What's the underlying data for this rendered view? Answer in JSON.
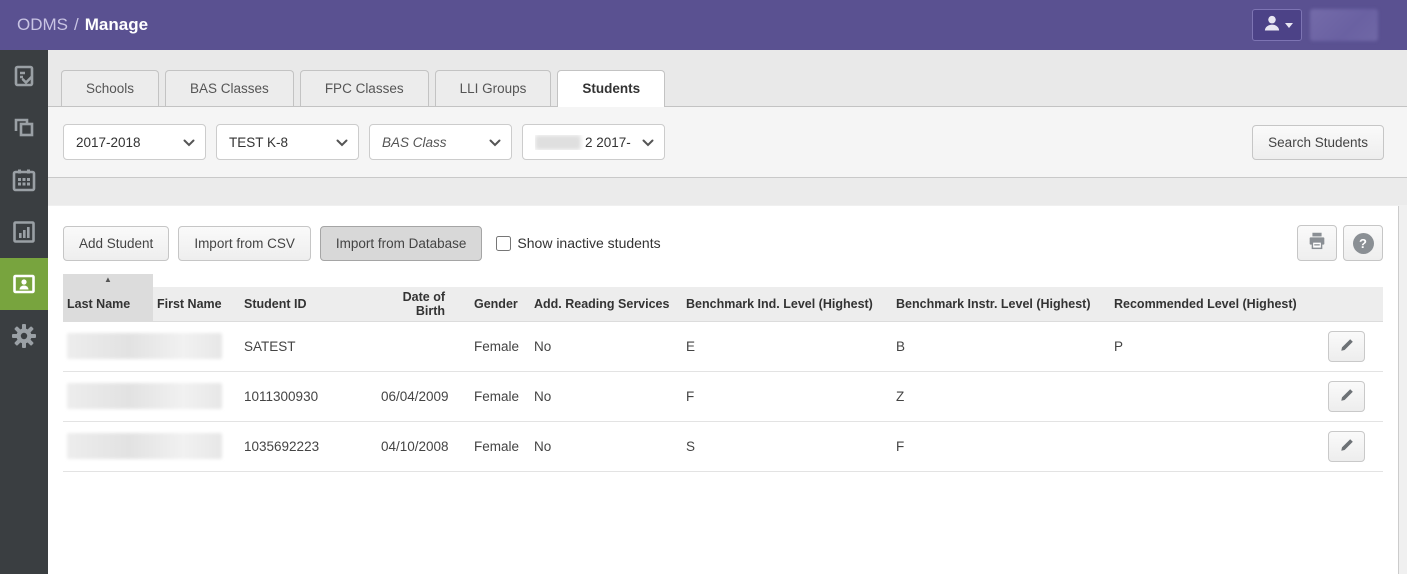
{
  "colors": {
    "accent_purple": "#5a5191",
    "accent_green": "#78a43e",
    "sidebar_bg": "#3a3e41"
  },
  "topbar": {
    "app": "ODMS",
    "separator": "/",
    "page": "Manage",
    "user_icon": "user-icon",
    "user_name_redacted": true
  },
  "sidebar": {
    "items": [
      {
        "icon": "assessment-checklist-icon",
        "active": false
      },
      {
        "icon": "classes-overlap-icon",
        "active": false
      },
      {
        "icon": "calendar-icon",
        "active": false
      },
      {
        "icon": "reports-chart-icon",
        "active": false
      },
      {
        "icon": "students-contact-card-icon",
        "active": true
      },
      {
        "icon": "settings-gear-icon",
        "active": false
      }
    ]
  },
  "tabs": {
    "items": [
      {
        "label": "Schools"
      },
      {
        "label": "BAS Classes"
      },
      {
        "label": "FPC Classes"
      },
      {
        "label": "LLI Groups"
      },
      {
        "label": "Students"
      }
    ],
    "active": "Students"
  },
  "filters": {
    "year_select": {
      "value": "2017-2018"
    },
    "school_select": {
      "value": "TEST K-8"
    },
    "class_type_select": {
      "value": "BAS Class",
      "italic": true
    },
    "class_select": {
      "redacted_prefix": true,
      "visible_text": "2 2017-"
    },
    "search_button": "Search Students"
  },
  "toolbar": {
    "add_student": "Add Student",
    "import_csv": "Import from CSV",
    "import_db": "Import from Database",
    "import_db_pressed": true,
    "show_inactive_label": "Show inactive students",
    "show_inactive_checked": false,
    "print_icon": "print-icon",
    "help_icon": "help-icon",
    "help_glyph": "?"
  },
  "table": {
    "sort": {
      "column": "Last Name",
      "direction": "asc",
      "arrow": "▲"
    },
    "columns": [
      "Last Name",
      "First Name",
      "Student ID",
      "Date of Birth",
      "Gender",
      "Add. Reading Services",
      "Benchmark Ind. Level (Highest)",
      "Benchmark Instr. Level (Highest)",
      "Recommended Level (Highest)"
    ],
    "rows": [
      {
        "name_redacted": true,
        "student_id": "SATEST",
        "dob": "",
        "gender": "Female",
        "add_reading_services": "No",
        "benchmark_ind": "E",
        "benchmark_instr": "B",
        "recommended": "P"
      },
      {
        "name_redacted": true,
        "student_id": "1011300930",
        "dob": "06/04/2009",
        "gender": "Female",
        "add_reading_services": "No",
        "benchmark_ind": "F",
        "benchmark_instr": "Z",
        "recommended": ""
      },
      {
        "name_redacted": true,
        "student_id": "1035692223",
        "dob": "04/10/2008",
        "gender": "Female",
        "add_reading_services": "No",
        "benchmark_ind": "S",
        "benchmark_instr": "F",
        "recommended": ""
      }
    ]
  }
}
